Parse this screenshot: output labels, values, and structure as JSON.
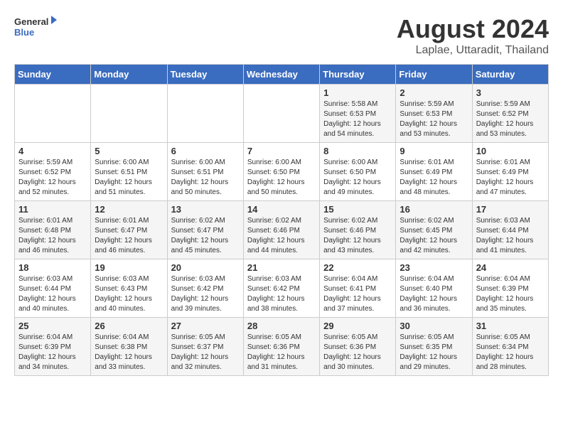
{
  "logo": {
    "text_general": "General",
    "text_blue": "Blue"
  },
  "header": {
    "month_year": "August 2024",
    "location": "Laplae, Uttaradit, Thailand"
  },
  "weekdays": [
    "Sunday",
    "Monday",
    "Tuesday",
    "Wednesday",
    "Thursday",
    "Friday",
    "Saturday"
  ],
  "weeks": [
    [
      {
        "day": "",
        "sunrise": "",
        "sunset": "",
        "daylight": ""
      },
      {
        "day": "",
        "sunrise": "",
        "sunset": "",
        "daylight": ""
      },
      {
        "day": "",
        "sunrise": "",
        "sunset": "",
        "daylight": ""
      },
      {
        "day": "",
        "sunrise": "",
        "sunset": "",
        "daylight": ""
      },
      {
        "day": "1",
        "sunrise": "Sunrise: 5:58 AM",
        "sunset": "Sunset: 6:53 PM",
        "daylight": "Daylight: 12 hours and 54 minutes."
      },
      {
        "day": "2",
        "sunrise": "Sunrise: 5:59 AM",
        "sunset": "Sunset: 6:53 PM",
        "daylight": "Daylight: 12 hours and 53 minutes."
      },
      {
        "day": "3",
        "sunrise": "Sunrise: 5:59 AM",
        "sunset": "Sunset: 6:52 PM",
        "daylight": "Daylight: 12 hours and 53 minutes."
      }
    ],
    [
      {
        "day": "4",
        "sunrise": "Sunrise: 5:59 AM",
        "sunset": "Sunset: 6:52 PM",
        "daylight": "Daylight: 12 hours and 52 minutes."
      },
      {
        "day": "5",
        "sunrise": "Sunrise: 6:00 AM",
        "sunset": "Sunset: 6:51 PM",
        "daylight": "Daylight: 12 hours and 51 minutes."
      },
      {
        "day": "6",
        "sunrise": "Sunrise: 6:00 AM",
        "sunset": "Sunset: 6:51 PM",
        "daylight": "Daylight: 12 hours and 50 minutes."
      },
      {
        "day": "7",
        "sunrise": "Sunrise: 6:00 AM",
        "sunset": "Sunset: 6:50 PM",
        "daylight": "Daylight: 12 hours and 50 minutes."
      },
      {
        "day": "8",
        "sunrise": "Sunrise: 6:00 AM",
        "sunset": "Sunset: 6:50 PM",
        "daylight": "Daylight: 12 hours and 49 minutes."
      },
      {
        "day": "9",
        "sunrise": "Sunrise: 6:01 AM",
        "sunset": "Sunset: 6:49 PM",
        "daylight": "Daylight: 12 hours and 48 minutes."
      },
      {
        "day": "10",
        "sunrise": "Sunrise: 6:01 AM",
        "sunset": "Sunset: 6:49 PM",
        "daylight": "Daylight: 12 hours and 47 minutes."
      }
    ],
    [
      {
        "day": "11",
        "sunrise": "Sunrise: 6:01 AM",
        "sunset": "Sunset: 6:48 PM",
        "daylight": "Daylight: 12 hours and 46 minutes."
      },
      {
        "day": "12",
        "sunrise": "Sunrise: 6:01 AM",
        "sunset": "Sunset: 6:47 PM",
        "daylight": "Daylight: 12 hours and 46 minutes."
      },
      {
        "day": "13",
        "sunrise": "Sunrise: 6:02 AM",
        "sunset": "Sunset: 6:47 PM",
        "daylight": "Daylight: 12 hours and 45 minutes."
      },
      {
        "day": "14",
        "sunrise": "Sunrise: 6:02 AM",
        "sunset": "Sunset: 6:46 PM",
        "daylight": "Daylight: 12 hours and 44 minutes."
      },
      {
        "day": "15",
        "sunrise": "Sunrise: 6:02 AM",
        "sunset": "Sunset: 6:46 PM",
        "daylight": "Daylight: 12 hours and 43 minutes."
      },
      {
        "day": "16",
        "sunrise": "Sunrise: 6:02 AM",
        "sunset": "Sunset: 6:45 PM",
        "daylight": "Daylight: 12 hours and 42 minutes."
      },
      {
        "day": "17",
        "sunrise": "Sunrise: 6:03 AM",
        "sunset": "Sunset: 6:44 PM",
        "daylight": "Daylight: 12 hours and 41 minutes."
      }
    ],
    [
      {
        "day": "18",
        "sunrise": "Sunrise: 6:03 AM",
        "sunset": "Sunset: 6:44 PM",
        "daylight": "Daylight: 12 hours and 40 minutes."
      },
      {
        "day": "19",
        "sunrise": "Sunrise: 6:03 AM",
        "sunset": "Sunset: 6:43 PM",
        "daylight": "Daylight: 12 hours and 40 minutes."
      },
      {
        "day": "20",
        "sunrise": "Sunrise: 6:03 AM",
        "sunset": "Sunset: 6:42 PM",
        "daylight": "Daylight: 12 hours and 39 minutes."
      },
      {
        "day": "21",
        "sunrise": "Sunrise: 6:03 AM",
        "sunset": "Sunset: 6:42 PM",
        "daylight": "Daylight: 12 hours and 38 minutes."
      },
      {
        "day": "22",
        "sunrise": "Sunrise: 6:04 AM",
        "sunset": "Sunset: 6:41 PM",
        "daylight": "Daylight: 12 hours and 37 minutes."
      },
      {
        "day": "23",
        "sunrise": "Sunrise: 6:04 AM",
        "sunset": "Sunset: 6:40 PM",
        "daylight": "Daylight: 12 hours and 36 minutes."
      },
      {
        "day": "24",
        "sunrise": "Sunrise: 6:04 AM",
        "sunset": "Sunset: 6:39 PM",
        "daylight": "Daylight: 12 hours and 35 minutes."
      }
    ],
    [
      {
        "day": "25",
        "sunrise": "Sunrise: 6:04 AM",
        "sunset": "Sunset: 6:39 PM",
        "daylight": "Daylight: 12 hours and 34 minutes."
      },
      {
        "day": "26",
        "sunrise": "Sunrise: 6:04 AM",
        "sunset": "Sunset: 6:38 PM",
        "daylight": "Daylight: 12 hours and 33 minutes."
      },
      {
        "day": "27",
        "sunrise": "Sunrise: 6:05 AM",
        "sunset": "Sunset: 6:37 PM",
        "daylight": "Daylight: 12 hours and 32 minutes."
      },
      {
        "day": "28",
        "sunrise": "Sunrise: 6:05 AM",
        "sunset": "Sunset: 6:36 PM",
        "daylight": "Daylight: 12 hours and 31 minutes."
      },
      {
        "day": "29",
        "sunrise": "Sunrise: 6:05 AM",
        "sunset": "Sunset: 6:36 PM",
        "daylight": "Daylight: 12 hours and 30 minutes."
      },
      {
        "day": "30",
        "sunrise": "Sunrise: 6:05 AM",
        "sunset": "Sunset: 6:35 PM",
        "daylight": "Daylight: 12 hours and 29 minutes."
      },
      {
        "day": "31",
        "sunrise": "Sunrise: 6:05 AM",
        "sunset": "Sunset: 6:34 PM",
        "daylight": "Daylight: 12 hours and 28 minutes."
      }
    ]
  ]
}
